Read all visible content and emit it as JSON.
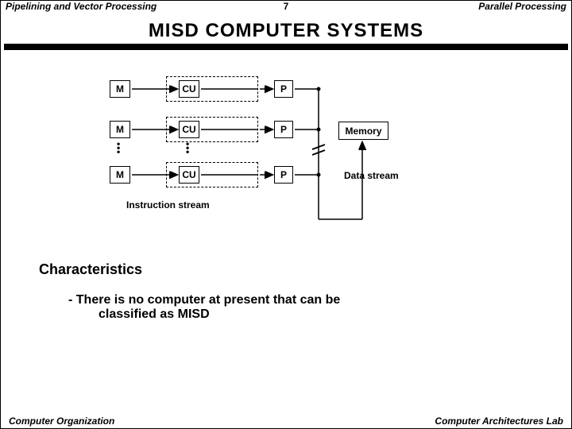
{
  "header": {
    "left": "Pipelining and Vector Processing",
    "page": "7",
    "right": "Parallel Processing"
  },
  "title": "MISD  COMPUTER  SYSTEMS",
  "diagram": {
    "m": "M",
    "cu": "CU",
    "p": "P",
    "memory": "Memory",
    "data_stream": "Data stream",
    "instruction_stream": "Instruction stream"
  },
  "sections": {
    "char_heading": "Characteristics",
    "bullet_line1": "- There is no computer at present that can be",
    "bullet_line2": "classified as MISD"
  },
  "footer": {
    "left": "Computer Organization",
    "right": "Computer Architectures Lab"
  }
}
